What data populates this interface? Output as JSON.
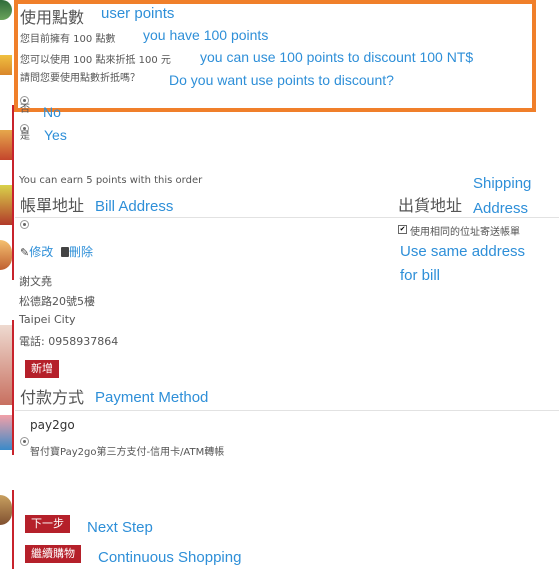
{
  "points": {
    "heading": "使用點數",
    "heading_note": "user points",
    "line1": "您目前擁有 100 點數",
    "line1_note": "you have 100 points",
    "line2": "您可以使用 100 點來折抵 100 元",
    "line2_note": "you can use 100 points to discount 100 NT$",
    "line3": "請問您要使用點數折抵嗎？",
    "line3_note": "Do you want use points to discount?",
    "option_no": "否",
    "option_no_note": "No",
    "option_yes": "是",
    "option_yes_note": "Yes"
  },
  "earn_text": "You can earn 5 points with this order",
  "bill": {
    "heading": "帳單地址",
    "heading_note": "Bill Address",
    "edit_label": "修改",
    "delete_label": "刪除",
    "name": "謝文堯",
    "street": "松德路20號5樓",
    "city": "Taipei City",
    "phone": "電話: 0958937864",
    "add_button": "新增"
  },
  "shipping": {
    "heading": "出貨地址",
    "heading_note_1": "Shipping",
    "heading_note_2": "Address",
    "same_label": "使用相同的位址寄送帳單",
    "same_note_1": "Use same address",
    "same_note_2": "for bill",
    "same_checked": true
  },
  "payment": {
    "heading": "付款方式",
    "heading_note": "Payment Method",
    "method_name": "pay2go",
    "method_desc": "智付寶Pay2go第三方支付-信用卡/ATM轉帳"
  },
  "actions": {
    "next_label": "下一步",
    "next_note": "Next Step",
    "continue_label": "繼續購物",
    "continue_note": "Continuous Shopping"
  },
  "colors": {
    "accent_red": "#b5202a",
    "annotation_blue": "#2e8fd8",
    "highlight_orange": "#f07f2a"
  }
}
